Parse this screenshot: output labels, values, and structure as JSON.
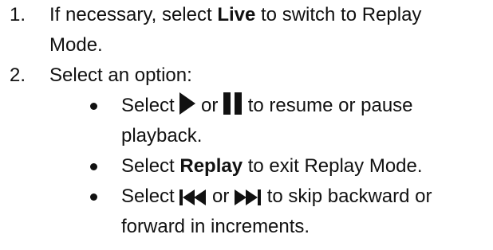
{
  "steps": [
    {
      "number": "1.",
      "text_before": "If necessary, select ",
      "bold": "Live",
      "text_after": " to switch to Replay Mode."
    },
    {
      "number": "2.",
      "text": "Select an option:",
      "bullets": [
        {
          "select": "Select",
          "or": "or",
          "rest": "to resume or pause playback.",
          "icon_a": "play-icon",
          "icon_b": "pause-icon"
        },
        {
          "select": "Select ",
          "bold": "Replay",
          "rest": " to exit Replay Mode."
        },
        {
          "select": "Select",
          "or": "or",
          "rest": "to skip backward or forward in increments.",
          "icon_a": "skip-backward-icon",
          "icon_b": "skip-forward-icon"
        }
      ]
    }
  ],
  "colors": {
    "text": "#111111",
    "background": "#ffffff"
  }
}
